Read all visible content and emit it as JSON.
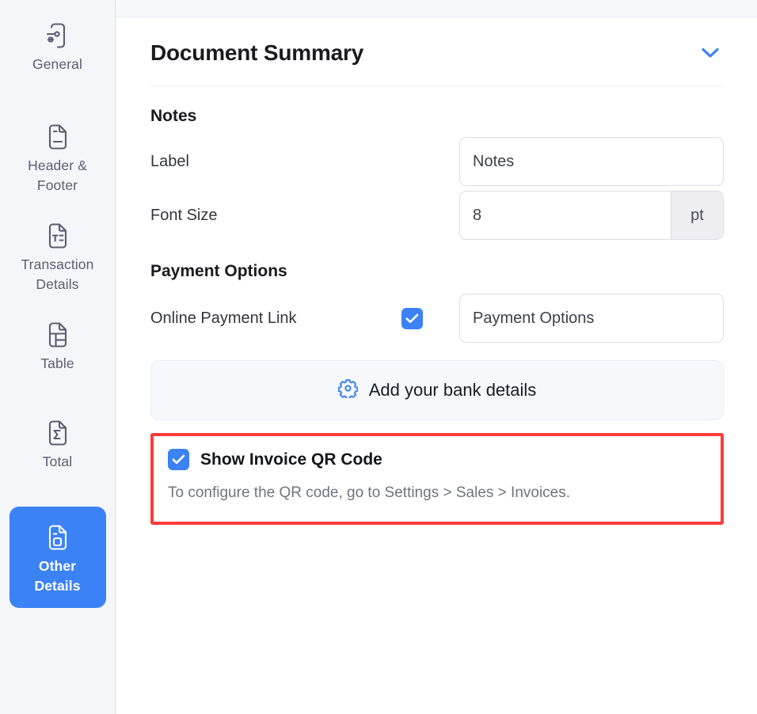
{
  "sidebar": {
    "items": [
      {
        "label": "General",
        "icon": "document-settings-icon",
        "active": false
      },
      {
        "label": "Header & Footer",
        "icon": "document-lines-icon",
        "active": false
      },
      {
        "label": "Transaction Details",
        "icon": "document-text-fields-icon",
        "active": false
      },
      {
        "label": "Table",
        "icon": "document-table-icon",
        "active": false
      },
      {
        "label": "Total",
        "icon": "document-sigma-icon",
        "active": false
      },
      {
        "label": "Other Details",
        "icon": "document-qr-icon",
        "active": true
      }
    ]
  },
  "panel": {
    "title": "Document Summary",
    "collapse_icon": "chevron-down-icon"
  },
  "notes": {
    "section_title": "Notes",
    "label_field": {
      "label": "Label",
      "value": "Notes",
      "placeholder": "Notes"
    },
    "font_size_field": {
      "label": "Font Size",
      "value": "8",
      "unit": "pt"
    }
  },
  "payment": {
    "section_title": "Payment Options",
    "online_link": {
      "label": "Online Payment Link",
      "checked": true,
      "value": "Payment Options",
      "placeholder": "Payment Options"
    },
    "bank_button": {
      "label": "Add your bank details",
      "icon": "gear-icon"
    }
  },
  "qr": {
    "label": "Show Invoice QR Code",
    "checked": true,
    "description": "To configure the QR code, go to Settings > Sales > Invoices."
  },
  "colors": {
    "accent": "#3b82f6",
    "highlight": "#fa3c3c",
    "sidebar_bg": "#f5f6fa",
    "icon": "#5a5e72",
    "text": "#1a1a1f",
    "muted": "#72747f"
  }
}
